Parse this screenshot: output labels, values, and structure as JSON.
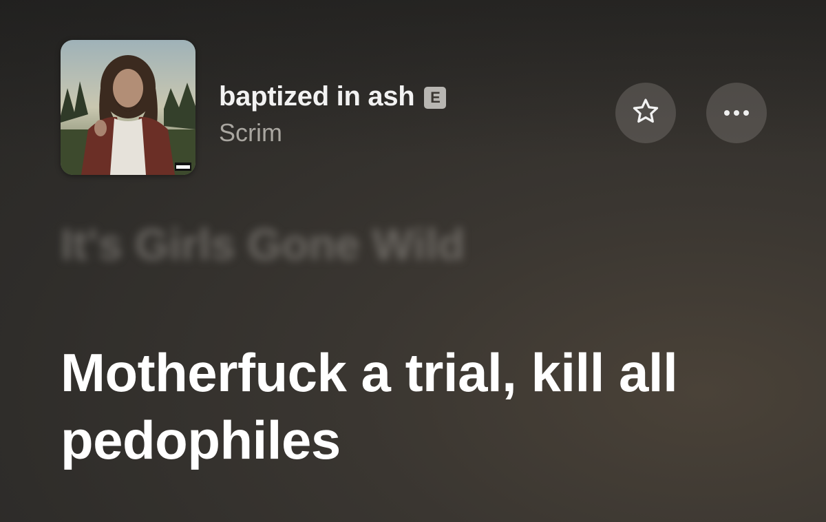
{
  "now_playing": {
    "track_title": "baptized in ash",
    "explicit_label": "E",
    "artist": "Scrim",
    "album_art_icon": "album-cover",
    "album_art_tag": "PARENTAL ADVISORY EXPLICIT CONTENT"
  },
  "actions": {
    "favorite_icon": "star-icon",
    "more_icon": "ellipsis-icon"
  },
  "lyrics": {
    "previous_line": "It's Girls Gone Wild",
    "current_line": "Motherfuck a trial, kill all pedophiles"
  },
  "colors": {
    "background": "#2f2d2a",
    "title": "#f2f2f2",
    "artist": "#a9a6a0",
    "lyric_current": "#ffffff"
  }
}
